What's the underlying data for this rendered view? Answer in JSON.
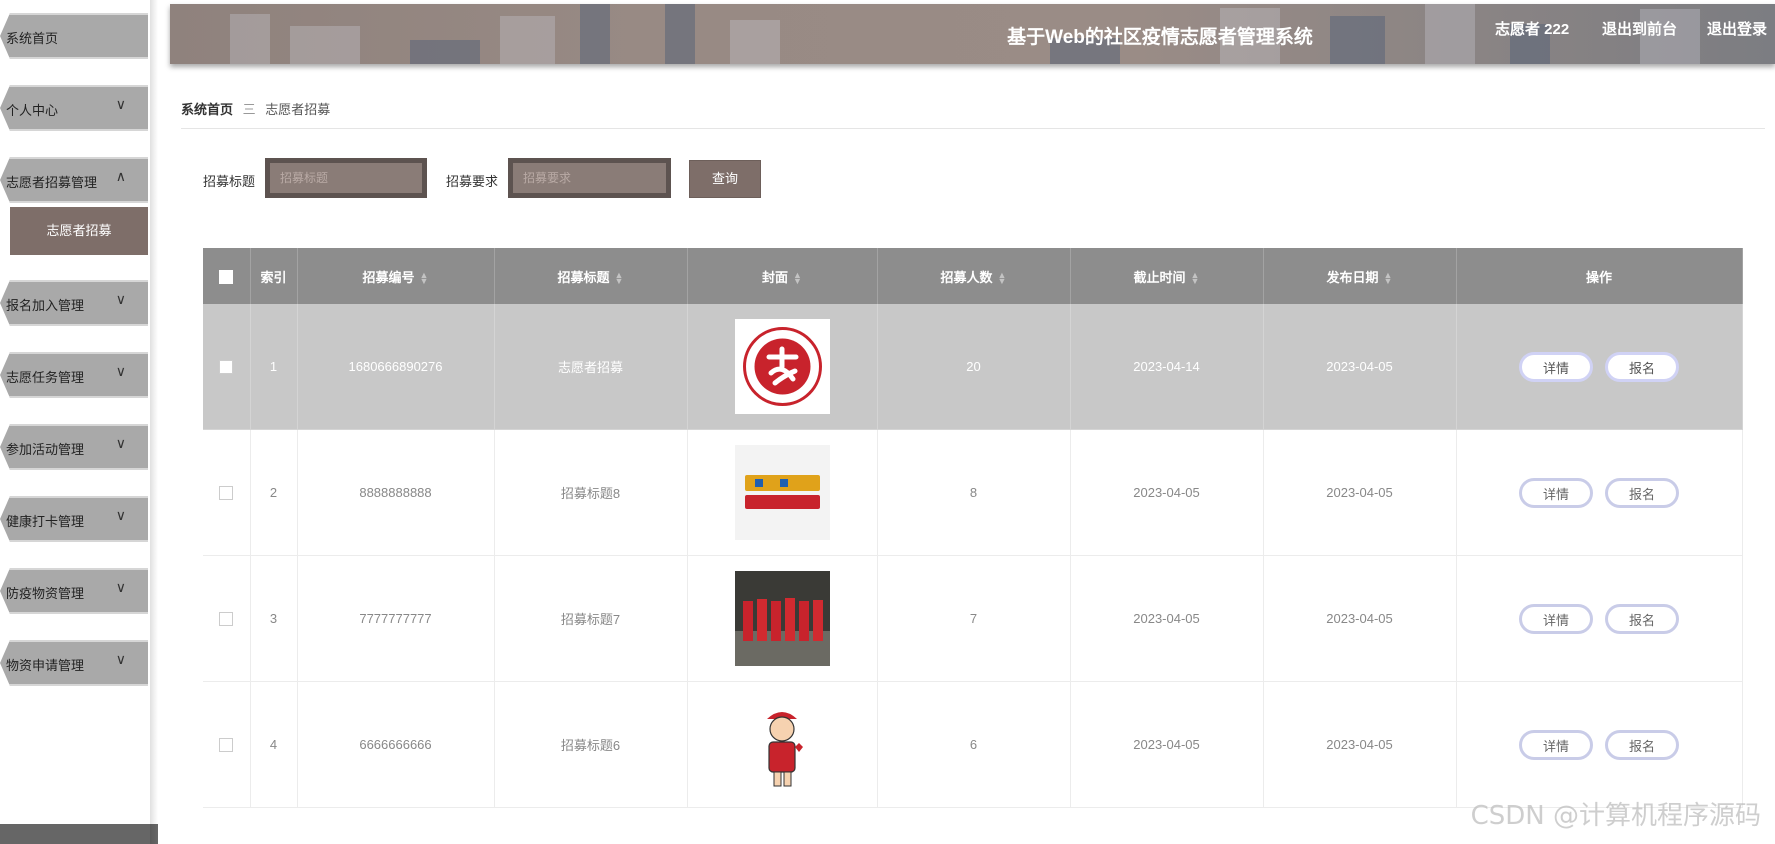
{
  "sidebar": {
    "items": [
      {
        "label": "系统首页",
        "expanded": null
      },
      {
        "label": "个人中心",
        "expanded": false
      },
      {
        "label": "志愿者招募管理",
        "expanded": true,
        "children": [
          "志愿者招募"
        ]
      },
      {
        "label": "报名加入管理",
        "expanded": false
      },
      {
        "label": "志愿任务管理",
        "expanded": false
      },
      {
        "label": "参加活动管理",
        "expanded": false
      },
      {
        "label": "健康打卡管理",
        "expanded": false
      },
      {
        "label": "防疫物资管理",
        "expanded": false
      },
      {
        "label": "物资申请管理",
        "expanded": false
      }
    ]
  },
  "header": {
    "title": "基于Web的社区疫情志愿者管理系统",
    "user": "志愿者 222",
    "to_front": "退出到前台",
    "logout": "退出登录"
  },
  "breadcrumb": {
    "home": "系统首页",
    "separator": "三",
    "current": "志愿者招募"
  },
  "search": {
    "title_label": "招募标题",
    "title_placeholder": "招募标题",
    "req_label": "招募要求",
    "req_placeholder": "招募要求",
    "button": "查询"
  },
  "table": {
    "columns": [
      "索引",
      "招募编号",
      "招募标题",
      "封面",
      "招募人数",
      "截止时间",
      "发布日期",
      "操作"
    ],
    "detail_label": "详情",
    "signup_label": "报名",
    "rows": [
      {
        "index": "1",
        "code": "1680666890276",
        "title": "志愿者招募",
        "cover": "volunteer-logo",
        "count": "20",
        "deadline": "2023-04-14",
        "published": "2023-04-05",
        "selected": true
      },
      {
        "index": "2",
        "code": "8888888888",
        "title": "招募标题8",
        "cover": "youth-volunteer-day",
        "count": "8",
        "deadline": "2023-04-05",
        "published": "2023-04-05",
        "selected": false
      },
      {
        "index": "3",
        "code": "7777777777",
        "title": "招募标题7",
        "cover": "group-photo",
        "count": "7",
        "deadline": "2023-04-05",
        "published": "2023-04-05",
        "selected": false
      },
      {
        "index": "4",
        "code": "6666666666",
        "title": "招募标题6",
        "cover": "volunteer-cartoon",
        "count": "6",
        "deadline": "2023-04-05",
        "published": "2023-04-05",
        "selected": false
      }
    ]
  },
  "colors": {
    "accent": "#7e6e69",
    "header_th": "#8d8d8d",
    "btn_border": "#c9cce8"
  },
  "watermark": "CSDN @计算机程序源码"
}
